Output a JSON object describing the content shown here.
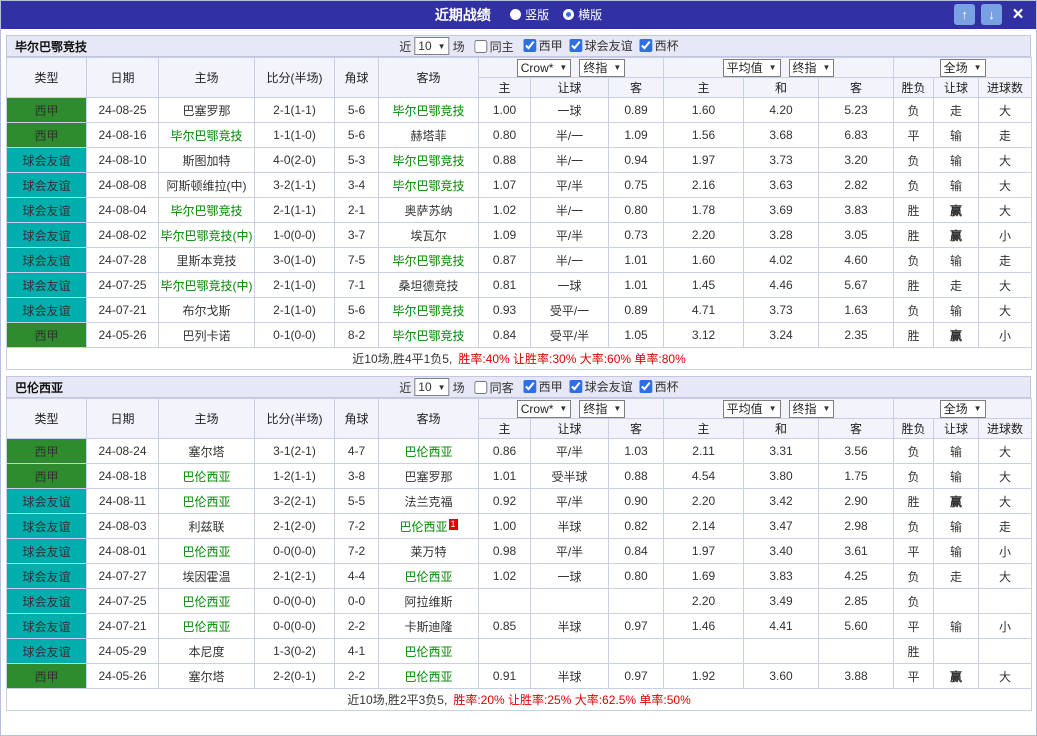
{
  "titlebar": {
    "title": "近期战绩",
    "view_options": [
      {
        "label": "竖版",
        "selected": false
      },
      {
        "label": "横版",
        "selected": true
      }
    ]
  },
  "icons": {
    "up_arrow": "↑",
    "down_arrow": "↓",
    "close": "×",
    "dropdown_arrow": "▼"
  },
  "colors": {
    "titlebar": "#3131A3",
    "button_blue": "#7AA2E2",
    "liga_green": "#2E8B2E",
    "friendly_teal": "#00AEAE",
    "focus_team_green": "#008800",
    "win_red": "#E10000",
    "draw_green": "#009900",
    "loss_blue": "#1515CC"
  },
  "table": {
    "main_headers": [
      "类型",
      "日期",
      "主场",
      "比分(半场)",
      "角球",
      "客场"
    ],
    "sub_headers": [
      "主",
      "让球",
      "客",
      "主",
      "和",
      "客",
      "胜负",
      "让球",
      "进球数"
    ],
    "odds_source": "Crow*",
    "odds_final": "终指",
    "avg_source": "平均值",
    "avg_final": "终指",
    "scope": "全场"
  },
  "sections": [
    {
      "team": "毕尔巴鄂竞技",
      "filter": {
        "prefix": "近",
        "count": "10",
        "suffix": "场",
        "same": {
          "label": "同主",
          "checked": false
        },
        "leagues": [
          {
            "label": "西甲",
            "checked": true
          },
          {
            "label": "球会友谊",
            "checked": true
          },
          {
            "label": "西杯",
            "checked": true
          }
        ]
      },
      "rows": [
        {
          "league": "西甲",
          "league_type": "liga",
          "date": "24-08-25",
          "home": "巴塞罗那",
          "home_focus": false,
          "score": "2-1(1-1)",
          "score_c": "red",
          "corner": "5-6",
          "away": "毕尔巴鄂竞技",
          "away_focus": true,
          "away_card": "",
          "o1": "1.00",
          "o2": "一球",
          "o3": "0.89",
          "a1": "1.60",
          "a2": "4.20",
          "a3": "5.23",
          "r": "负",
          "r_c": "red",
          "h": "走",
          "h_c": "green",
          "g": "大",
          "g_c": "red"
        },
        {
          "league": "西甲",
          "league_type": "liga",
          "date": "24-08-16",
          "home": "毕尔巴鄂竞技",
          "home_focus": true,
          "score": "1-1(1-0)",
          "score_c": "green",
          "corner": "5-6",
          "away": "赫塔菲",
          "away_focus": false,
          "away_card": "",
          "o1": "0.80",
          "o2": "半/一",
          "o3": "1.09",
          "a1": "1.56",
          "a2": "3.68",
          "a3": "6.83",
          "r": "平",
          "r_c": "green",
          "h": "输",
          "h_c": "blue",
          "g": "走",
          "g_c": "green"
        },
        {
          "league": "球会友谊",
          "league_type": "friendly",
          "date": "24-08-10",
          "home": "斯图加特",
          "home_focus": false,
          "score": "4-0(2-0)",
          "score_c": "red",
          "corner": "5-3",
          "away": "毕尔巴鄂竞技",
          "away_focus": true,
          "away_card": "",
          "o1": "0.88",
          "o2": "半/一",
          "o3": "0.94",
          "a1": "1.97",
          "a2": "3.73",
          "a3": "3.20",
          "r": "负",
          "r_c": "red",
          "h": "输",
          "h_c": "blue",
          "g": "大",
          "g_c": "red"
        },
        {
          "league": "球会友谊",
          "league_type": "friendly",
          "date": "24-08-08",
          "home": "阿斯顿维拉(中)",
          "home_focus": false,
          "score": "3-2(1-1)",
          "score_c": "red",
          "corner": "3-4",
          "away": "毕尔巴鄂竞技",
          "away_focus": true,
          "away_card": "",
          "o1": "1.07",
          "o2": "平/半",
          "o3": "0.75",
          "a1": "2.16",
          "a2": "3.63",
          "a3": "2.82",
          "r": "负",
          "r_c": "red",
          "h": "输",
          "h_c": "blue",
          "g": "大",
          "g_c": "red"
        },
        {
          "league": "球会友谊",
          "league_type": "friendly",
          "date": "24-08-04",
          "home": "毕尔巴鄂竞技",
          "home_focus": true,
          "score": "2-1(1-1)",
          "score_c": "red",
          "corner": "2-1",
          "away": "奥萨苏纳",
          "away_focus": false,
          "away_card": "",
          "o1": "1.02",
          "o2": "半/一",
          "o3": "0.80",
          "a1": "1.78",
          "a2": "3.69",
          "a3": "3.83",
          "r": "胜",
          "r_c": "red",
          "h": "赢",
          "h_c": "red",
          "g": "大",
          "g_c": "red"
        },
        {
          "league": "球会友谊",
          "league_type": "friendly",
          "date": "24-08-02",
          "home": "毕尔巴鄂竞技(中)",
          "home_focus": true,
          "score": "1-0(0-0)",
          "score_c": "red",
          "corner": "3-7",
          "away": "埃瓦尔",
          "away_focus": false,
          "away_card": "",
          "o1": "1.09",
          "o2": "平/半",
          "o3": "0.73",
          "a1": "2.20",
          "a2": "3.28",
          "a3": "3.05",
          "r": "胜",
          "r_c": "red",
          "h": "赢",
          "h_c": "red",
          "g": "小",
          "g_c": "blue"
        },
        {
          "league": "球会友谊",
          "league_type": "friendly",
          "date": "24-07-28",
          "home": "里斯本竞技",
          "home_focus": false,
          "score": "3-0(1-0)",
          "score_c": "red",
          "corner": "7-5",
          "away": "毕尔巴鄂竞技",
          "away_focus": true,
          "away_card": "",
          "o1": "0.87",
          "o2": "半/一",
          "o3": "1.01",
          "a1": "1.60",
          "a2": "4.02",
          "a3": "4.60",
          "r": "负",
          "r_c": "red",
          "h": "输",
          "h_c": "blue",
          "g": "走",
          "g_c": "green"
        },
        {
          "league": "球会友谊",
          "league_type": "friendly",
          "date": "24-07-25",
          "home": "毕尔巴鄂竞技(中)",
          "home_focus": true,
          "score": "2-1(1-0)",
          "score_c": "red",
          "corner": "7-1",
          "away": "桑坦德竞技",
          "away_focus": false,
          "away_card": "",
          "o1": "0.81",
          "o2": "一球",
          "o3": "1.01",
          "a1": "1.45",
          "a2": "4.46",
          "a3": "5.67",
          "r": "胜",
          "r_c": "red",
          "h": "走",
          "h_c": "green",
          "g": "大",
          "g_c": "red"
        },
        {
          "league": "球会友谊",
          "league_type": "friendly",
          "date": "24-07-21",
          "home": "布尔戈斯",
          "home_focus": false,
          "score": "2-1(1-0)",
          "score_c": "red",
          "corner": "5-6",
          "away": "毕尔巴鄂竞技",
          "away_focus": true,
          "away_card": "",
          "o1": "0.93",
          "o2": "受平/一",
          "o3": "0.89",
          "a1": "4.71",
          "a2": "3.73",
          "a3": "1.63",
          "r": "负",
          "r_c": "red",
          "h": "输",
          "h_c": "blue",
          "g": "大",
          "g_c": "red"
        },
        {
          "league": "西甲",
          "league_type": "liga",
          "date": "24-05-26",
          "home": "巴列卡诺",
          "home_focus": false,
          "score": "0-1(0-0)",
          "score_c": "red",
          "corner": "8-2",
          "away": "毕尔巴鄂竞技",
          "away_focus": true,
          "away_card": "",
          "o1": "0.84",
          "o2": "受平/半",
          "o3": "1.05",
          "a1": "3.12",
          "a2": "3.24",
          "a3": "2.35",
          "r": "胜",
          "r_c": "red",
          "h": "赢",
          "h_c": "red",
          "g": "小",
          "g_c": "blue"
        }
      ],
      "summary": {
        "prefix": "近10场,胜4平1负5,",
        "stats": "胜率:40% 让胜率:30% 大率:60% 单率:80%"
      }
    },
    {
      "team": "巴伦西亚",
      "filter": {
        "prefix": "近",
        "count": "10",
        "suffix": "场",
        "same": {
          "label": "同客",
          "checked": false
        },
        "leagues": [
          {
            "label": "西甲",
            "checked": true
          },
          {
            "label": "球会友谊",
            "checked": true
          },
          {
            "label": "西杯",
            "checked": true
          }
        ]
      },
      "rows": [
        {
          "league": "西甲",
          "league_type": "liga",
          "date": "24-08-24",
          "home": "塞尔塔",
          "home_focus": false,
          "score": "3-1(2-1)",
          "score_c": "red",
          "corner": "4-7",
          "away": "巴伦西亚",
          "away_focus": true,
          "away_card": "",
          "o1": "0.86",
          "o2": "平/半",
          "o3": "1.03",
          "a1": "2.11",
          "a2": "3.31",
          "a3": "3.56",
          "r": "负",
          "r_c": "red",
          "h": "输",
          "h_c": "blue",
          "g": "大",
          "g_c": "red"
        },
        {
          "league": "西甲",
          "league_type": "liga",
          "date": "24-08-18",
          "home": "巴伦西亚",
          "home_focus": true,
          "score": "1-2(1-1)",
          "score_c": "red",
          "corner": "3-8",
          "away": "巴塞罗那",
          "away_focus": false,
          "away_card": "",
          "o1": "1.01",
          "o2": "受半球",
          "o3": "0.88",
          "a1": "4.54",
          "a2": "3.80",
          "a3": "1.75",
          "r": "负",
          "r_c": "red",
          "h": "输",
          "h_c": "blue",
          "g": "大",
          "g_c": "red"
        },
        {
          "league": "球会友谊",
          "league_type": "friendly",
          "date": "24-08-11",
          "home": "巴伦西亚",
          "home_focus": true,
          "score": "3-2(2-1)",
          "score_c": "red",
          "corner": "5-5",
          "away": "法兰克福",
          "away_focus": false,
          "away_card": "",
          "o1": "0.92",
          "o2": "平/半",
          "o3": "0.90",
          "a1": "2.20",
          "a2": "3.42",
          "a3": "2.90",
          "r": "胜",
          "r_c": "red",
          "h": "赢",
          "h_c": "red",
          "g": "大",
          "g_c": "red"
        },
        {
          "league": "球会友谊",
          "league_type": "friendly",
          "date": "24-08-03",
          "home": "利兹联",
          "home_focus": false,
          "score": "2-1(2-0)",
          "score_c": "red",
          "corner": "7-2",
          "away": "巴伦西亚",
          "away_focus": true,
          "away_card": "1",
          "o1": "1.00",
          "o2": "半球",
          "o3": "0.82",
          "a1": "2.14",
          "a2": "3.47",
          "a3": "2.98",
          "r": "负",
          "r_c": "red",
          "h": "输",
          "h_c": "blue",
          "g": "走",
          "g_c": "green"
        },
        {
          "league": "球会友谊",
          "league_type": "friendly",
          "date": "24-08-01",
          "home": "巴伦西亚",
          "home_focus": true,
          "score": "0-0(0-0)",
          "score_c": "green",
          "corner": "7-2",
          "away": "莱万特",
          "away_focus": false,
          "away_card": "",
          "o1": "0.98",
          "o2": "平/半",
          "o3": "0.84",
          "a1": "1.97",
          "a2": "3.40",
          "a3": "3.61",
          "r": "平",
          "r_c": "green",
          "h": "输",
          "h_c": "blue",
          "g": "小",
          "g_c": "blue"
        },
        {
          "league": "球会友谊",
          "league_type": "friendly",
          "date": "24-07-27",
          "home": "埃因霍温",
          "home_focus": false,
          "score": "2-1(2-1)",
          "score_c": "red",
          "corner": "4-4",
          "away": "巴伦西亚",
          "away_focus": true,
          "away_card": "",
          "o1": "1.02",
          "o2": "一球",
          "o3": "0.80",
          "a1": "1.69",
          "a2": "3.83",
          "a3": "4.25",
          "r": "负",
          "r_c": "red",
          "h": "走",
          "h_c": "green",
          "g": "大",
          "g_c": "red"
        },
        {
          "league": "球会友谊",
          "league_type": "friendly",
          "date": "24-07-25",
          "home": "巴伦西亚",
          "home_focus": true,
          "score": "0-0(0-0)",
          "score_c": "green",
          "corner": "0-0",
          "away": "阿拉维斯",
          "away_focus": false,
          "away_card": "",
          "o1": "",
          "o2": "",
          "o3": "",
          "a1": "2.20",
          "a2": "3.49",
          "a3": "2.85",
          "r": "负",
          "r_c": "red",
          "h": "",
          "h_c": "",
          "g": "",
          "g_c": ""
        },
        {
          "league": "球会友谊",
          "league_type": "friendly",
          "date": "24-07-21",
          "home": "巴伦西亚",
          "home_focus": true,
          "score": "0-0(0-0)",
          "score_c": "green",
          "corner": "2-2",
          "away": "卡斯迪隆",
          "away_focus": false,
          "away_card": "",
          "o1": "0.85",
          "o2": "半球",
          "o3": "0.97",
          "a1": "1.46",
          "a2": "4.41",
          "a3": "5.60",
          "r": "平",
          "r_c": "green",
          "h": "输",
          "h_c": "blue",
          "g": "小",
          "g_c": "blue"
        },
        {
          "league": "球会友谊",
          "league_type": "friendly",
          "date": "24-05-29",
          "home": "本尼度",
          "home_focus": false,
          "score": "1-3(0-2)",
          "score_c": "red",
          "corner": "4-1",
          "away": "巴伦西亚",
          "away_focus": true,
          "away_card": "",
          "o1": "",
          "o2": "",
          "o3": "",
          "a1": "",
          "a2": "",
          "a3": "",
          "r": "胜",
          "r_c": "red",
          "h": "",
          "h_c": "",
          "g": "",
          "g_c": ""
        },
        {
          "league": "西甲",
          "league_type": "liga",
          "date": "24-05-26",
          "home": "塞尔塔",
          "home_focus": false,
          "score": "2-2(0-1)",
          "score_c": "red",
          "corner": "2-2",
          "away": "巴伦西亚",
          "away_focus": true,
          "away_card": "",
          "o1": "0.91",
          "o2": "半球",
          "o3": "0.97",
          "a1": "1.92",
          "a2": "3.60",
          "a3": "3.88",
          "r": "平",
          "r_c": "green",
          "h": "赢",
          "h_c": "red",
          "g": "大",
          "g_c": "red"
        }
      ],
      "summary": {
        "prefix": "近10场,胜2平3负5,",
        "stats": "胜率:20% 让胜率:25% 大率:62.5% 单率:50%"
      }
    }
  ]
}
